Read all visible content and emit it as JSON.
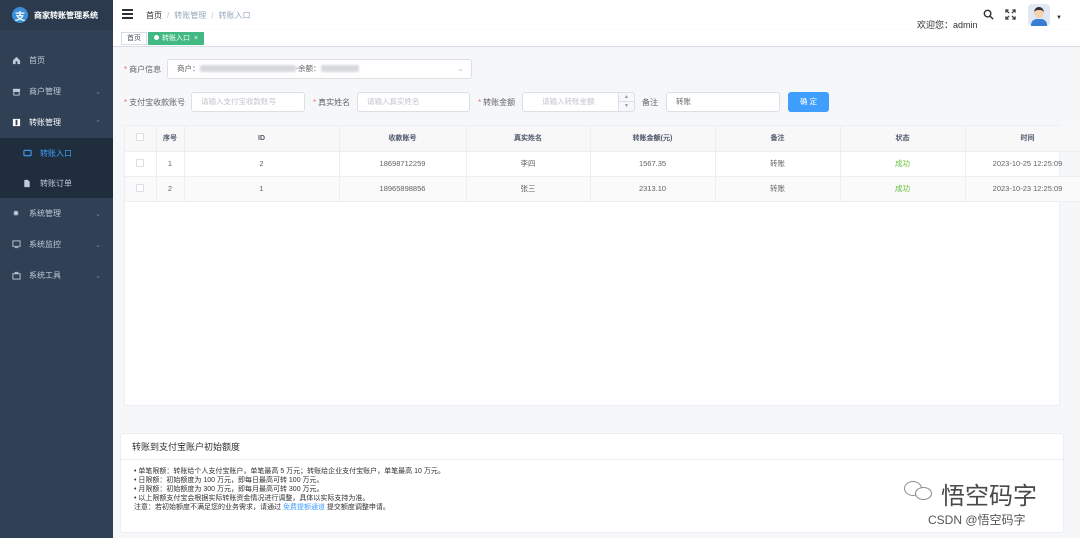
{
  "app": {
    "title": "商家转账管理系统",
    "logo_char": "支"
  },
  "sidebar": {
    "items": [
      {
        "label": "首页",
        "icon": "home-icon"
      },
      {
        "label": "商户管理",
        "icon": "shop-icon"
      },
      {
        "label": "转账管理",
        "icon": "book-icon",
        "expanded": true
      },
      {
        "label": "系统管理",
        "icon": "gear-icon"
      },
      {
        "label": "系统监控",
        "icon": "monitor-icon"
      },
      {
        "label": "系统工具",
        "icon": "toolbox-icon"
      }
    ],
    "sub_items": [
      {
        "label": "转账入口",
        "icon": "window-icon",
        "active": true
      },
      {
        "label": "转账订单",
        "icon": "document-icon"
      }
    ]
  },
  "header": {
    "breadcrumb": [
      "首页",
      "转账管理",
      "转账入口"
    ],
    "welcome": "欢迎您：admin"
  },
  "tags": [
    {
      "label": "首页",
      "active": false
    },
    {
      "label": "转账入口",
      "active": true
    }
  ],
  "form": {
    "merchant_label": "商户信息",
    "merchant_value_prefix": "商户：",
    "merchant_value_mid": "-余额：",
    "account_label": "支付宝收款账号",
    "account_placeholder": "请输入支付宝收款账号",
    "realname_label": "真实姓名",
    "realname_placeholder": "请输入真实姓名",
    "amount_label": "转账金额",
    "amount_placeholder": "请输入转账金额",
    "remark_label": "备注",
    "remark_value": "转账",
    "submit_label": "确 定",
    "accent_color": "#409eff"
  },
  "table": {
    "headers": [
      "序号",
      "ID",
      "收款账号",
      "真实姓名",
      "转账金额(元)",
      "备注",
      "状态",
      "时间"
    ],
    "rows": [
      [
        "1",
        "2",
        "18698712259",
        "李四",
        "1567.35",
        "转账",
        "成功",
        "2023-10-25 12:25:09"
      ],
      [
        "2",
        "1",
        "18965898856",
        "张三",
        "2313.10",
        "转账",
        "成功",
        "2023-10-23 12:25:09"
      ]
    ],
    "status_color": "#67c23a"
  },
  "info": {
    "title": "转账到支付宝账户初始额度",
    "lines": [
      "• 单笔限额：转账给个人支付宝账户，单笔最高 5 万元；转账给企业支付宝账户，单笔最高 10 万元。",
      "• 日限额：初始额度为 100 万元，即每日最高可转 100 万元。",
      "• 月限额：初始额度为 300 万元，即每月最高可转 300 万元。",
      "• 以上限额支付宝会根据实际转账资金情况进行调整，具体以实际支持为准。"
    ],
    "note_prefix": "注意：若初始额度不满足您的业务需求，请通过",
    "note_link": "免费提额通道",
    "note_suffix": "提交额度调整申请。"
  },
  "watermark": {
    "name": "悟空码字",
    "source": "CSDN @悟空码字"
  }
}
